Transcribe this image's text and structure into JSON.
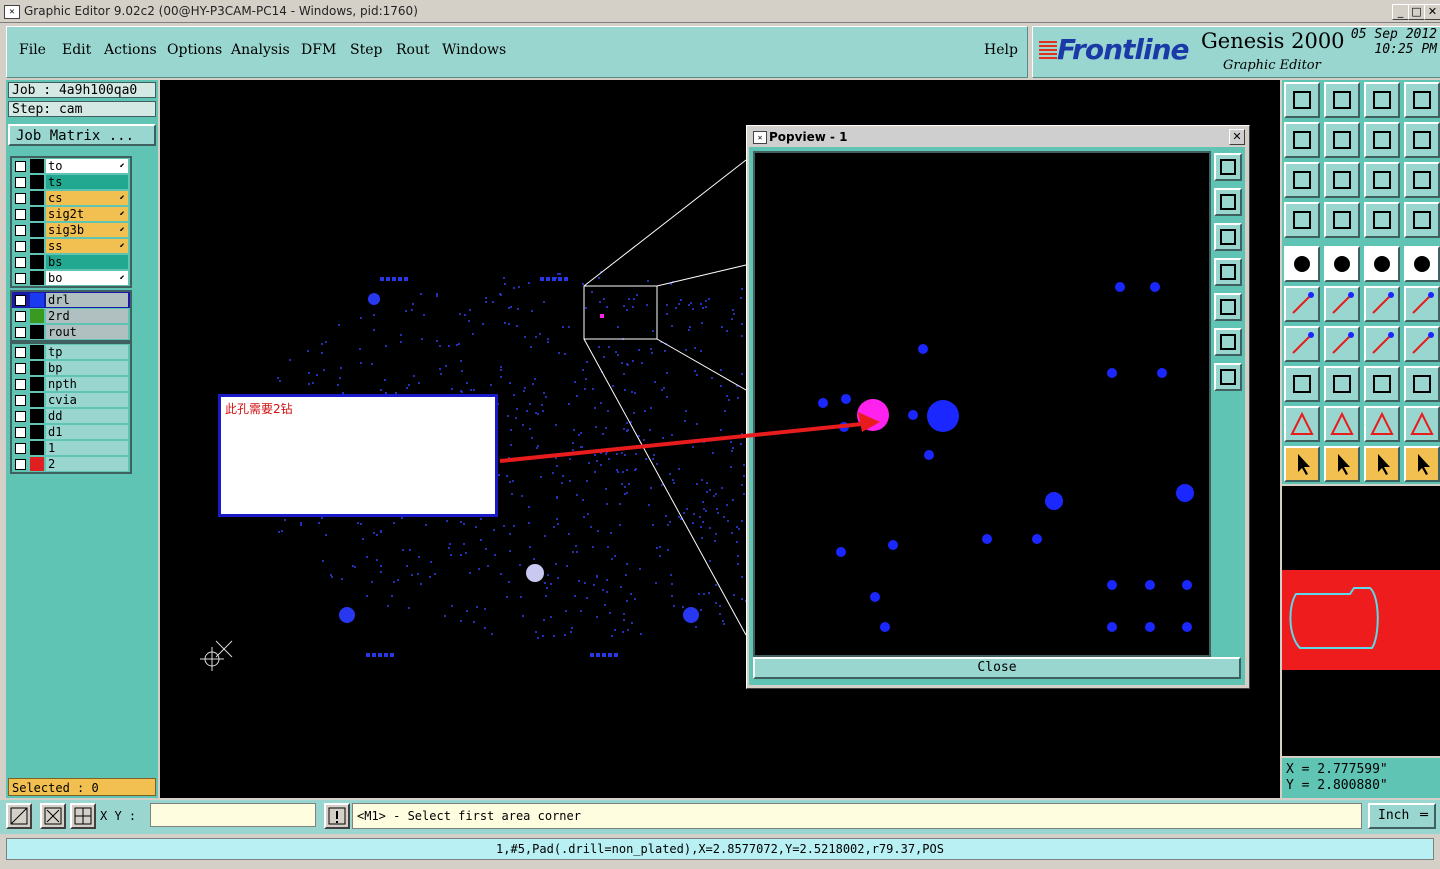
{
  "window": {
    "title": "Graphic Editor 9.02c2 (00@HY-P3CAM-PC14 - Windows, pid:1760)"
  },
  "menu": {
    "items": [
      "File",
      "Edit",
      "Actions",
      "Options",
      "Analysis",
      "DFM",
      "Step",
      "Rout",
      "Windows"
    ],
    "help": "Help"
  },
  "logo": {
    "brand": "Frontline",
    "product": "Genesis 2000",
    "subtitle": "Graphic Editor",
    "date": "05 Sep 2012",
    "time": "10:25 PM"
  },
  "job": {
    "job_label": "Job : 4a9h100qa0",
    "step_label": "Step: cam",
    "matrix_button": "Job Matrix ..."
  },
  "layers": {
    "group1": [
      {
        "name": "to",
        "color": "#ffffff",
        "swatch": "#000000"
      },
      {
        "name": "ts",
        "color": "#22a890",
        "swatch": "#000000"
      },
      {
        "name": "cs",
        "color": "#f2c050",
        "swatch": "#000000"
      },
      {
        "name": "sig2t",
        "color": "#f2c050",
        "swatch": "#000000"
      },
      {
        "name": "sig3b",
        "color": "#f2c050",
        "swatch": "#000000"
      },
      {
        "name": "ss",
        "color": "#f2c050",
        "swatch": "#000000"
      },
      {
        "name": "bs",
        "color": "#22a890",
        "swatch": "#000000"
      },
      {
        "name": "bo",
        "color": "#ffffff",
        "swatch": "#000000"
      }
    ],
    "group2": [
      {
        "name": "drl",
        "color": "#b0c0c0",
        "swatch": "#1a3af0"
      },
      {
        "name": "2rd",
        "color": "#b0c0c0",
        "swatch": "#3a9a20"
      },
      {
        "name": "rout",
        "color": "#b0c0c0",
        "swatch": "#000000"
      }
    ],
    "group3": [
      {
        "name": "tp",
        "color": "#99d6d0",
        "swatch": "#000000"
      },
      {
        "name": "bp",
        "color": "#99d6d0",
        "swatch": "#000000"
      },
      {
        "name": "npth",
        "color": "#99d6d0",
        "swatch": "#000000"
      },
      {
        "name": "cvia",
        "color": "#99d6d0",
        "swatch": "#000000"
      },
      {
        "name": "dd",
        "color": "#99d6d0",
        "swatch": "#000000"
      },
      {
        "name": "d1",
        "color": "#99d6d0",
        "swatch": "#000000"
      },
      {
        "name": "1",
        "color": "#99d6d0",
        "swatch": "#000000"
      },
      {
        "name": "2",
        "color": "#99d6d0",
        "swatch": "#e02020"
      }
    ]
  },
  "selected": "Selected : 0",
  "note": {
    "text": "此孔需要2钻"
  },
  "popview": {
    "title": "Popview - 1",
    "close_label": "Close"
  },
  "coords": {
    "x": "X = 2.777599\"",
    "y": "Y = 2.800880\""
  },
  "bottom": {
    "xy_label": "X Y :",
    "prompt": "<M1> - Select first area corner",
    "unit": "Inch"
  },
  "status": "1,#5,Pad(.drill=non_plated),X=2.8577072,Y=2.5218002,r79.37,POS",
  "colors": {
    "panel": "#5fc4b4",
    "menu": "#99d6d0",
    "drill": "#1a3af0",
    "highlight": "#ff22ee",
    "arrow": "#e81c1c"
  }
}
